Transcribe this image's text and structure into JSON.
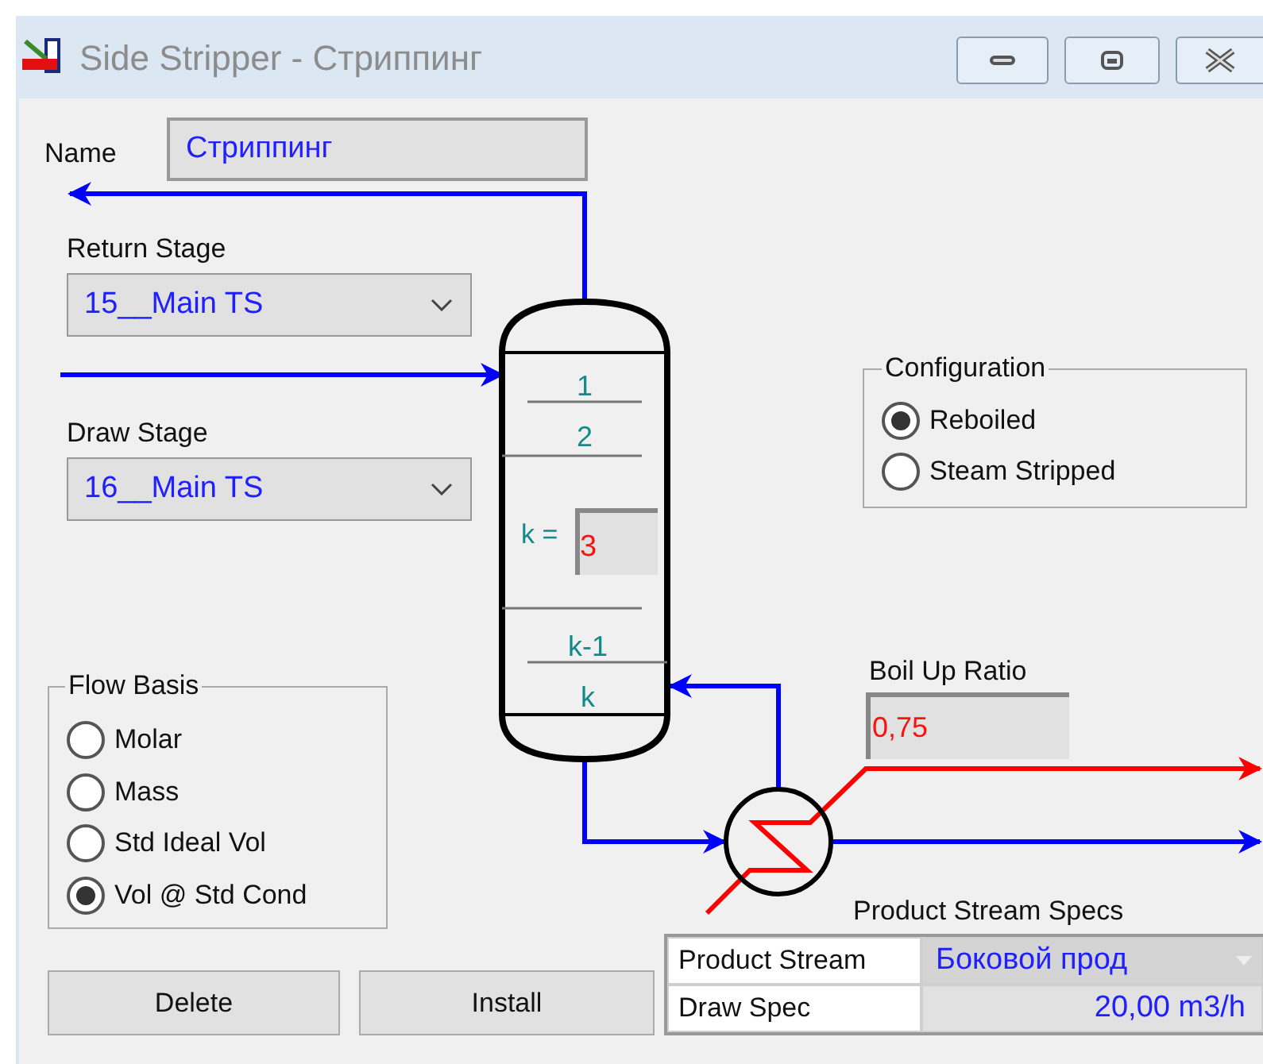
{
  "window": {
    "title": "Side Stripper - Стриппинг"
  },
  "name": {
    "label": "Name",
    "value": "Стриппинг"
  },
  "return_stage": {
    "label": "Return Stage",
    "value": "15__Main TS"
  },
  "draw_stage": {
    "label": "Draw Stage",
    "value": "16__Main TS"
  },
  "column": {
    "stage_labels": [
      "1",
      "2",
      "k-1",
      "k"
    ],
    "k_label": "k =",
    "k_value": "3"
  },
  "configuration": {
    "title": "Configuration",
    "options": [
      {
        "label": "Reboiled",
        "selected": true
      },
      {
        "label": "Steam Stripped",
        "selected": false
      }
    ]
  },
  "boil_up_ratio": {
    "label": "Boil Up Ratio",
    "value": "0,75"
  },
  "flow_basis": {
    "title": "Flow Basis",
    "options": [
      {
        "label": "Molar",
        "selected": false
      },
      {
        "label": "Mass",
        "selected": false
      },
      {
        "label": "Std Ideal Vol",
        "selected": false
      },
      {
        "label": "Vol @ Std Cond",
        "selected": true
      }
    ]
  },
  "buttons": [
    "Delete",
    "Install"
  ],
  "product_stream_specs": {
    "title": "Product Stream Specs",
    "rows": [
      {
        "kind": "dropdown",
        "label": "Product Stream",
        "value": "Боковой прод"
      },
      {
        "kind": "value",
        "label": "Draw Spec",
        "value": "20,00 m3/h"
      }
    ]
  }
}
